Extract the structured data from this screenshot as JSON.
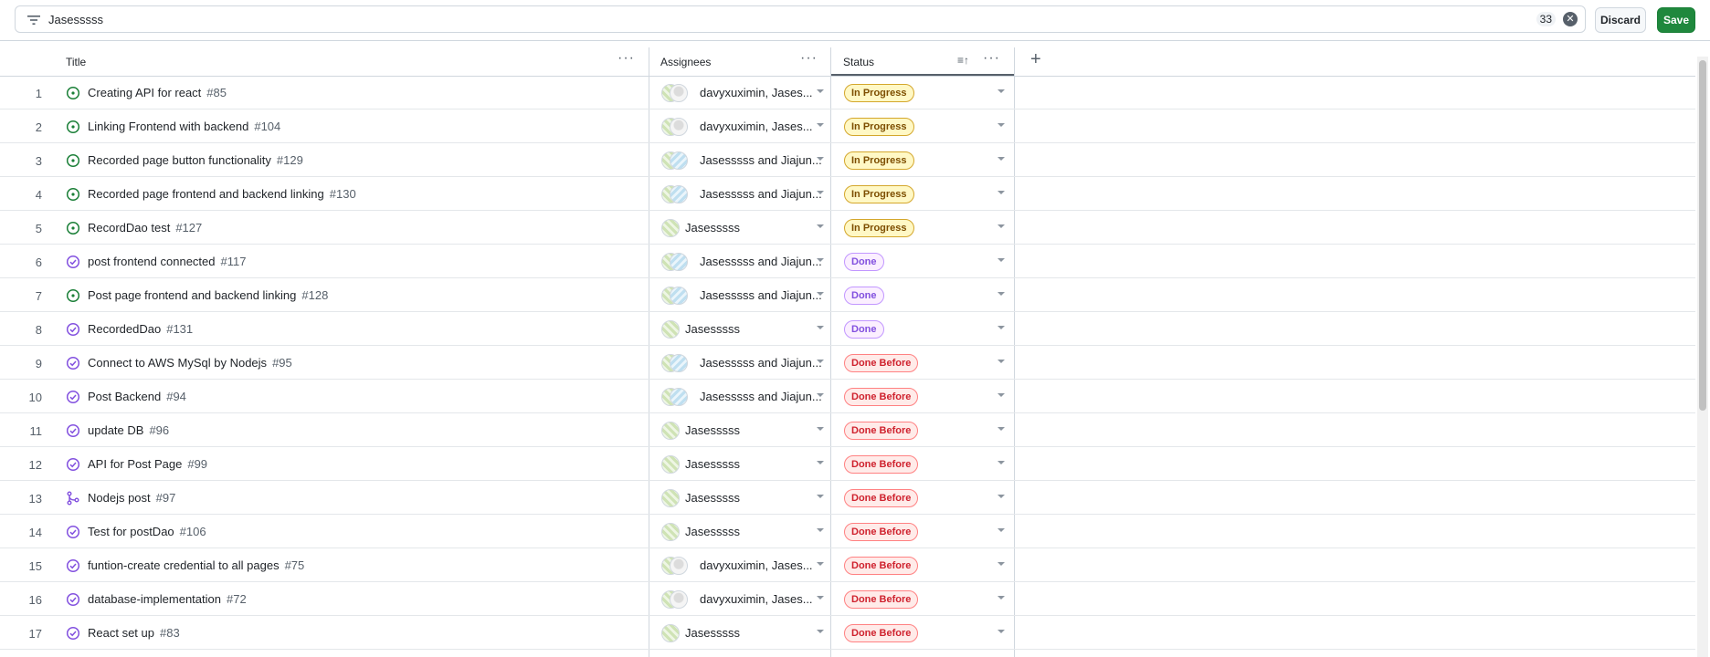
{
  "filter": {
    "query": "Jasesssss",
    "match_count": "33"
  },
  "actions": {
    "discard_label": "Discard",
    "save_label": "Save"
  },
  "columns": {
    "title": "Title",
    "assignees": "Assignees",
    "status": "Status"
  },
  "colors": {
    "accent_green": "#1f883d",
    "open_icon": "#1a7f37",
    "closed_icon": "#8250df",
    "in_progress": "#bf8700",
    "done": "#8250df",
    "done_before": "#cf222e"
  },
  "rows": [
    {
      "n": "1",
      "icon": "issue-open",
      "title": "Creating API for react",
      "num": "#85",
      "assignees": "davyxuximin, Jases...",
      "avatars": [
        "a",
        "c"
      ],
      "status": "In Progress",
      "status_kind": "inprogress"
    },
    {
      "n": "2",
      "icon": "issue-open",
      "title": "Linking Frontend with backend",
      "num": "#104",
      "assignees": "davyxuximin, Jases...",
      "avatars": [
        "a",
        "c"
      ],
      "status": "In Progress",
      "status_kind": "inprogress"
    },
    {
      "n": "3",
      "icon": "issue-open",
      "title": "Recorded page button functionality",
      "num": "#129",
      "assignees": "Jasesssss and Jiajun...",
      "avatars": [
        "a",
        "b"
      ],
      "status": "In Progress",
      "status_kind": "inprogress"
    },
    {
      "n": "4",
      "icon": "issue-open",
      "title": "Recorded page frontend and backend linking",
      "num": "#130",
      "assignees": "Jasesssss and Jiajun...",
      "avatars": [
        "a",
        "b"
      ],
      "status": "In Progress",
      "status_kind": "inprogress"
    },
    {
      "n": "5",
      "icon": "issue-open",
      "title": "RecordDao test",
      "num": "#127",
      "assignees": "Jasesssss",
      "avatars": [
        "a"
      ],
      "status": "In Progress",
      "status_kind": "inprogress"
    },
    {
      "n": "6",
      "icon": "issue-closed",
      "title": "post frontend connected",
      "num": "#117",
      "assignees": "Jasesssss and Jiajun...",
      "avatars": [
        "a",
        "b"
      ],
      "status": "Done",
      "status_kind": "done"
    },
    {
      "n": "7",
      "icon": "issue-open",
      "title": "Post page frontend and backend linking",
      "num": "#128",
      "assignees": "Jasesssss and Jiajun...",
      "avatars": [
        "a",
        "b"
      ],
      "status": "Done",
      "status_kind": "done"
    },
    {
      "n": "8",
      "icon": "issue-closed",
      "title": "RecordedDao",
      "num": "#131",
      "assignees": "Jasesssss",
      "avatars": [
        "a"
      ],
      "status": "Done",
      "status_kind": "done"
    },
    {
      "n": "9",
      "icon": "issue-closed",
      "title": "Connect to AWS MySql by Nodejs",
      "num": "#95",
      "assignees": "Jasesssss and Jiajun...",
      "avatars": [
        "a",
        "b"
      ],
      "status": "Done Before",
      "status_kind": "donebefore"
    },
    {
      "n": "10",
      "icon": "issue-closed",
      "title": "Post Backend",
      "num": "#94",
      "assignees": "Jasesssss and Jiajun...",
      "avatars": [
        "a",
        "b"
      ],
      "status": "Done Before",
      "status_kind": "donebefore"
    },
    {
      "n": "11",
      "icon": "issue-closed",
      "title": "update DB",
      "num": "#96",
      "assignees": "Jasesssss",
      "avatars": [
        "a"
      ],
      "status": "Done Before",
      "status_kind": "donebefore"
    },
    {
      "n": "12",
      "icon": "issue-closed",
      "title": "API for Post Page",
      "num": "#99",
      "assignees": "Jasesssss",
      "avatars": [
        "a"
      ],
      "status": "Done Before",
      "status_kind": "donebefore"
    },
    {
      "n": "13",
      "icon": "pr-merged",
      "title": "Nodejs post",
      "num": "#97",
      "assignees": "Jasesssss",
      "avatars": [
        "a"
      ],
      "status": "Done Before",
      "status_kind": "donebefore"
    },
    {
      "n": "14",
      "icon": "issue-closed",
      "title": "Test for postDao",
      "num": "#106",
      "assignees": "Jasesssss",
      "avatars": [
        "a"
      ],
      "status": "Done Before",
      "status_kind": "donebefore"
    },
    {
      "n": "15",
      "icon": "issue-closed",
      "title": "funtion-create credential to all pages",
      "num": "#75",
      "assignees": "davyxuximin, Jases...",
      "avatars": [
        "a",
        "c"
      ],
      "status": "Done Before",
      "status_kind": "donebefore"
    },
    {
      "n": "16",
      "icon": "issue-closed",
      "title": "database-implementation",
      "num": "#72",
      "assignees": "davyxuximin, Jases...",
      "avatars": [
        "a",
        "c"
      ],
      "status": "Done Before",
      "status_kind": "donebefore"
    },
    {
      "n": "17",
      "icon": "issue-closed",
      "title": "React set up",
      "num": "#83",
      "assignees": "Jasesssss",
      "avatars": [
        "a"
      ],
      "status": "Done Before",
      "status_kind": "donebefore"
    }
  ]
}
